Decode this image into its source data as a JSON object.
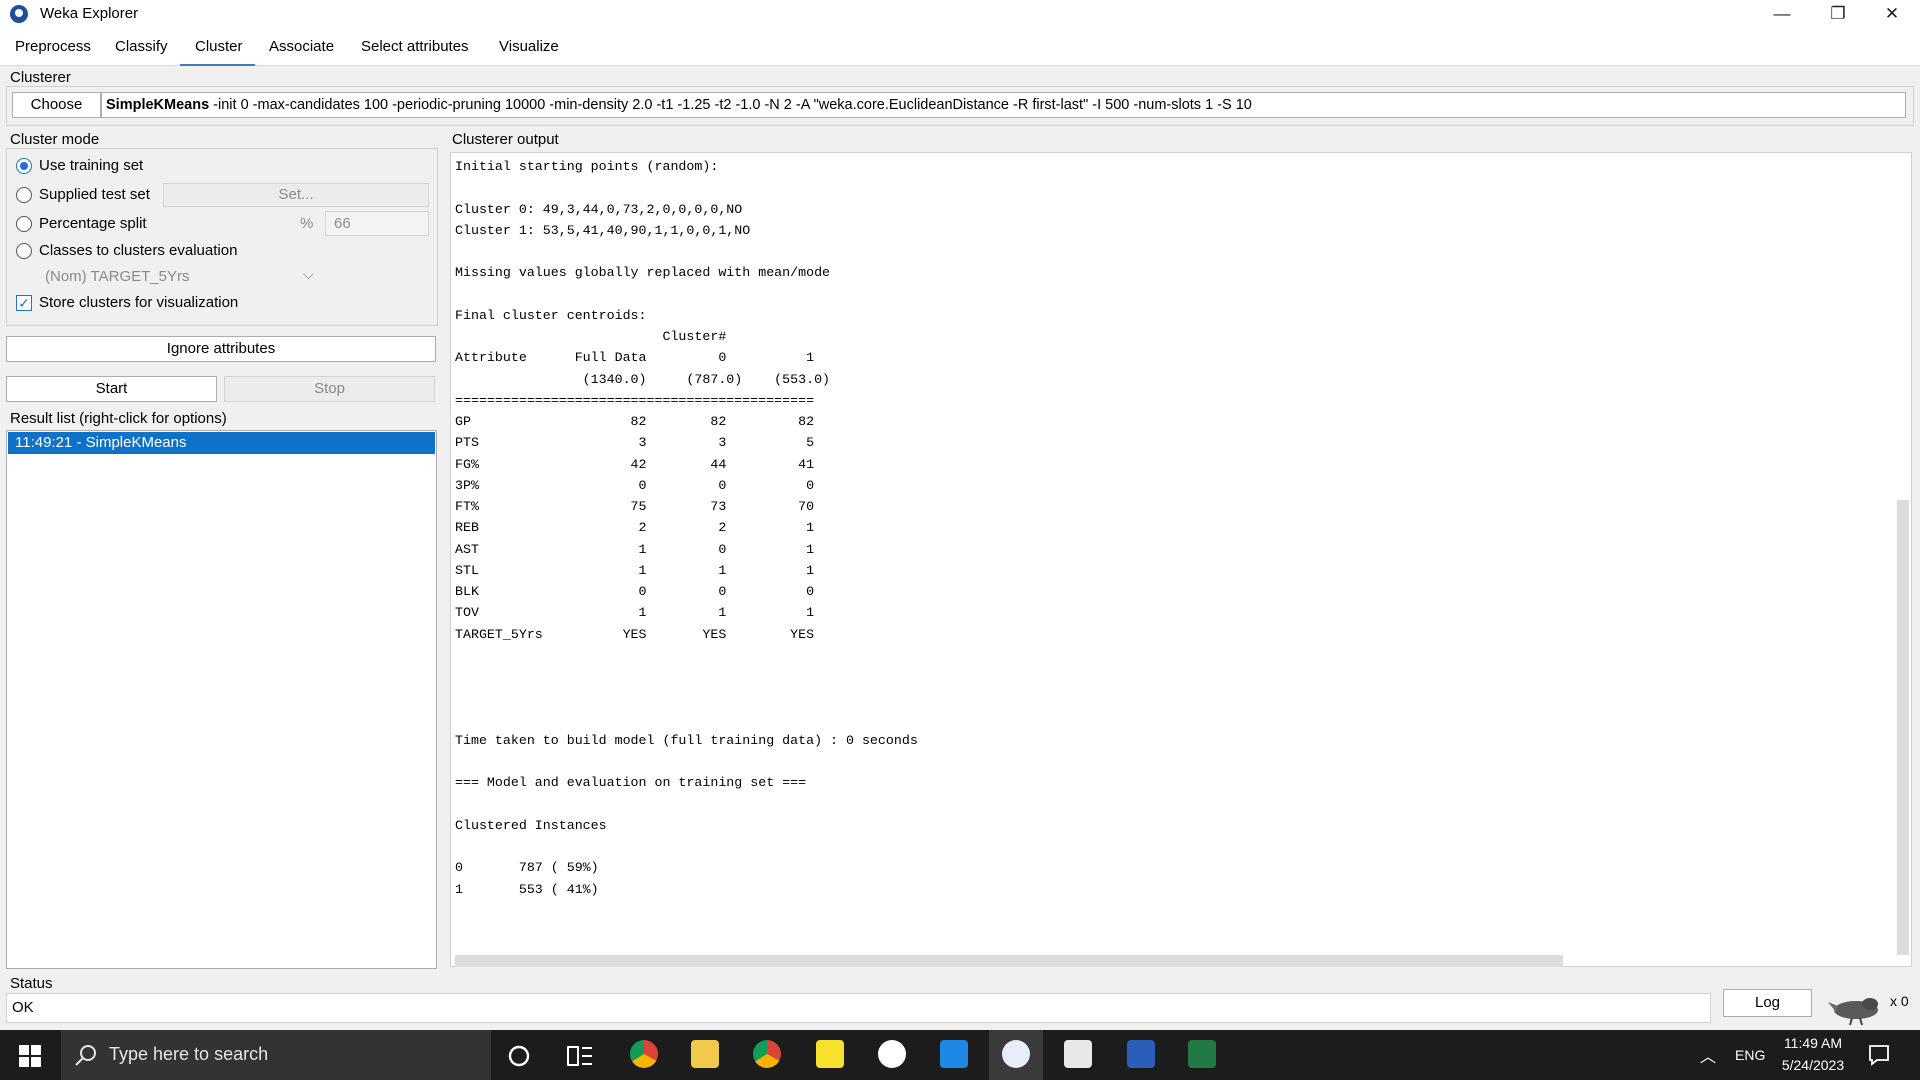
{
  "window": {
    "title": "Weka Explorer",
    "minimize": "—",
    "maximize": "❐",
    "close": "✕"
  },
  "tabs": [
    "Preprocess",
    "Classify",
    "Cluster",
    "Associate",
    "Select attributes",
    "Visualize"
  ],
  "clusterer": {
    "group_label": "Clusterer",
    "choose_label": "Choose",
    "algorithm": "SimpleKMeans",
    "options": " -init 0 -max-candidates 100 -periodic-pruning 10000 -min-density 2.0 -t1 -1.25 -t2 -1.0 -N 2 -A \"weka.core.EuclideanDistance -R first-last\" -I 500 -num-slots 1 -S 10"
  },
  "cluster_mode": {
    "group_label": "Cluster mode",
    "use_training_set": "Use training set",
    "supplied_test_set": "Supplied test set",
    "set_button": "Set...",
    "percentage_split": "Percentage split",
    "percent_symbol": "%",
    "percent_value": "66",
    "classes_to_clusters": "Classes to clusters evaluation",
    "class_attribute": "(Nom) TARGET_5Yrs",
    "store_clusters": "Store clusters for visualization",
    "selected": "use_training_set",
    "store_checked": true
  },
  "buttons": {
    "ignore_attributes": "Ignore attributes",
    "start": "Start",
    "stop": "Stop",
    "log": "Log"
  },
  "result_list": {
    "label": "Result list (right-click for options)",
    "items": [
      "11:49:21 - SimpleKMeans"
    ]
  },
  "output": {
    "label": "Clusterer output",
    "text": "Initial starting points (random):\n\nCluster 0: 49,3,44,0,73,2,0,0,0,0,NO\nCluster 1: 53,5,41,40,90,1,1,0,0,1,NO\n\nMissing values globally replaced with mean/mode\n\nFinal cluster centroids:\n                          Cluster#\nAttribute      Full Data         0          1\n                (1340.0)     (787.0)    (553.0)\n=============================================\nGP                    82        82         82\nPTS                    3         3          5\nFG%                   42        44         41\n3P%                    0         0          0\nFT%                   75        73         70\nREB                    2         2          1\nAST                    1         0          1\nSTL                    1         1          1\nBLK                    0         0          0\nTOV                    1         1          1\nTARGET_5Yrs          YES       YES        YES\n\n\n\n\nTime taken to build model (full training data) : 0 seconds\n\n=== Model and evaluation on training set ===\n\nClustered Instances\n\n0       787 ( 59%)\n1       553 ( 41%)"
  },
  "status": {
    "label": "Status",
    "text": "OK",
    "task_count": "x 0"
  },
  "taskbar": {
    "search_placeholder": "Type here to search",
    "language": "ENG",
    "time": "11:49 AM",
    "date": "5/24/2023"
  },
  "colors": {
    "accent": "#0f72c9",
    "tab_underline": "#3c7fc1",
    "taskbar": "#1c1c1c"
  }
}
